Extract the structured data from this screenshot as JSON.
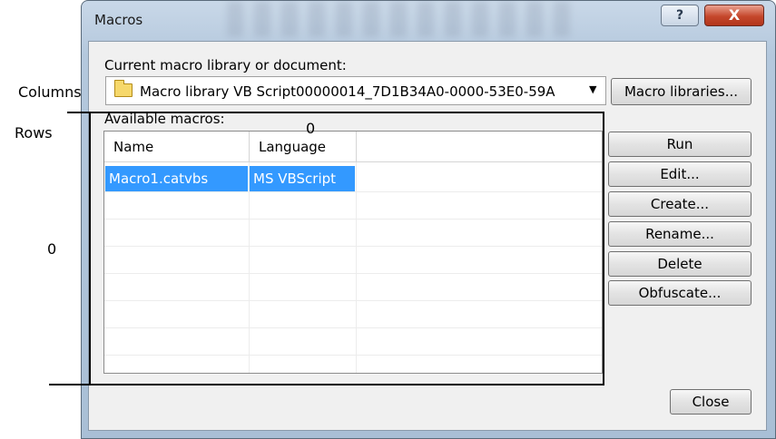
{
  "window": {
    "title": "Macros",
    "help_label": "?",
    "close_label": "X"
  },
  "library": {
    "label": "Current macro library or document:",
    "selected": "Macro library VB Script00000014_7D1B34A0-0000-53E0-59A",
    "icon": "folder-icon",
    "libraries_button": "Macro libraries..."
  },
  "macros": {
    "label": "Available macros:",
    "columns": [
      "Name",
      "Language"
    ],
    "rows": [
      {
        "name": "Macro1.catvbs",
        "language": "MS VBScript",
        "selected": true
      }
    ],
    "selection_color": "#3399ff"
  },
  "actions": [
    "Run",
    "Edit...",
    "Create...",
    "Rename...",
    "Delete",
    "Obfuscate..."
  ],
  "footer": {
    "close_button": "Close"
  },
  "annotations": {
    "columns_label": "Columns",
    "rows_label": "Rows",
    "columns_value": "0",
    "rows_value": "0"
  }
}
